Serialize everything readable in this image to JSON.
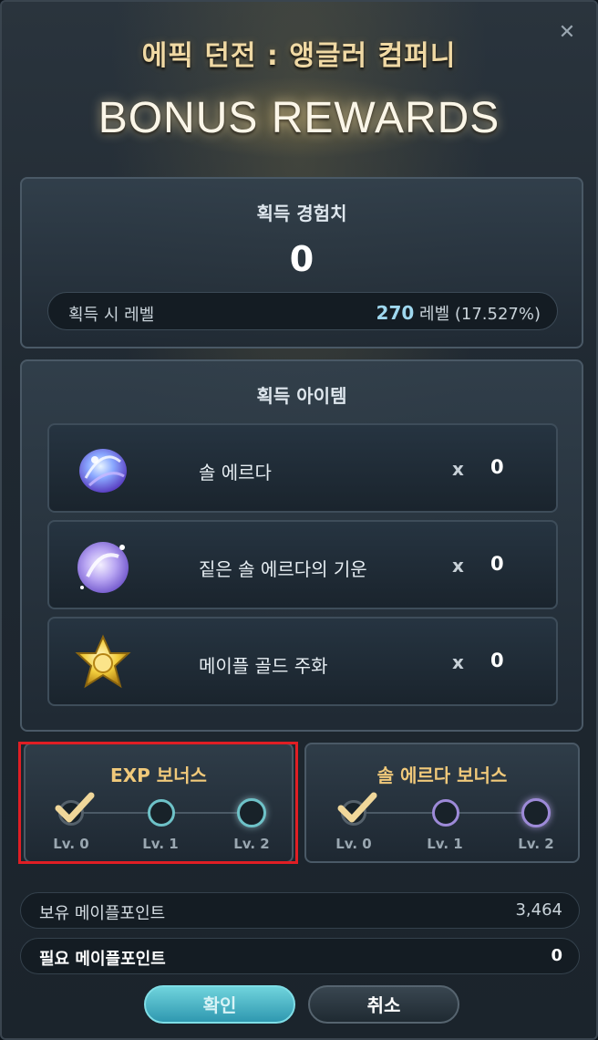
{
  "header": {
    "dungeon_title": "에픽 던전 : 앵글러 컴퍼니",
    "banner": "BONUS REWARDS",
    "close_icon": "close-icon"
  },
  "exp_panel": {
    "title": "획득 경험치",
    "value": "0",
    "level_label": "획득 시 레벨",
    "level_number": "270",
    "level_suffix": "레벨 (17.527%)"
  },
  "items_panel": {
    "title": "획득 아이템",
    "items": [
      {
        "name": "솔 에르다",
        "x": "x",
        "qty": "0",
        "icon": "sol-erda-icon"
      },
      {
        "name": "짙은 솔 에르다의 기운",
        "x": "x",
        "qty": "0",
        "icon": "sol-erda-fragment-icon"
      },
      {
        "name": "메이플 골드 주화",
        "x": "x",
        "qty": "0",
        "icon": "maple-gold-coin-icon"
      }
    ]
  },
  "exp_bonus": {
    "title": "EXP 보너스",
    "levels": [
      "Lv. 0",
      "Lv. 1",
      "Lv. 2"
    ],
    "selected": 0,
    "color": "#6ec2c8"
  },
  "sol_bonus": {
    "title": "솔 에르다 보너스",
    "levels": [
      "Lv. 0",
      "Lv. 1",
      "Lv. 2"
    ],
    "selected": 0,
    "color": "#9d8ad8"
  },
  "points": {
    "hold_label": "보유 메이플포인트",
    "hold_value": "3,464",
    "need_label": "필요 메이플포인트",
    "need_value": "0"
  },
  "buttons": {
    "ok": "확인",
    "cancel": "취소"
  },
  "colors": {
    "highlight": "#e01e24",
    "accent_gold": "#f0c97a"
  }
}
